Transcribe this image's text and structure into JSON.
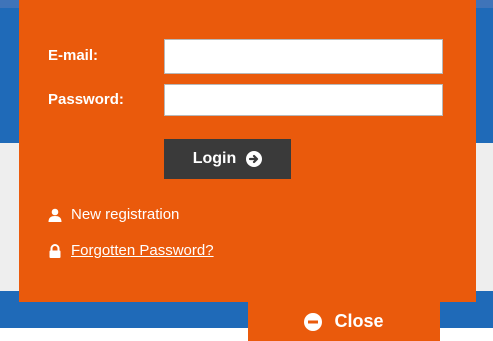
{
  "login_form": {
    "email_label": "E-mail:",
    "email_value": "",
    "password_label": "Password:",
    "password_value": "",
    "login_label": "Login"
  },
  "links": {
    "register_label": "New registration",
    "forgot_label": "Forgotten Password?"
  },
  "close_tab": {
    "label": "Close"
  },
  "icons": {
    "login": "circle-arrow-right-icon",
    "register": "user-icon",
    "forgot": "lock-icon",
    "close": "circle-minus-icon"
  },
  "colors": {
    "panel_orange": "#ea5a0c",
    "button_dark": "#3a3a3a",
    "page_blue": "#1f6ab8",
    "text_white": "#ffffff"
  }
}
